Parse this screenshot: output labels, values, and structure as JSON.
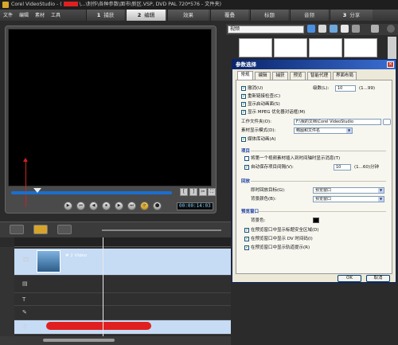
{
  "titlebar": {
    "app": "Corel VideoStudio - (",
    "after_redact": "\\...\\制作\\各种参数\\面市\\新区.VSP, DVD PAL 720*576 - 文件夹)"
  },
  "menu": {
    "file": "文件",
    "edit": "编辑",
    "clip": "素材",
    "tools": "工具"
  },
  "steps": [
    {
      "num": "1",
      "label": "捕获"
    },
    {
      "num": "2",
      "label": "编辑"
    },
    {
      "num": "",
      "label": "效果"
    },
    {
      "num": "",
      "label": "覆叠"
    },
    {
      "num": "",
      "label": "标题"
    },
    {
      "num": "",
      "label": "音频"
    },
    {
      "num": "3",
      "label": "分享"
    }
  ],
  "player": {
    "timecode": "00:00:14:03",
    "buttons": [
      "▶",
      "⏮",
      "◀",
      "⏹",
      "▶",
      "⏭",
      "⟳",
      "⬤"
    ]
  },
  "library": {
    "category": "视频"
  },
  "dialog": {
    "title": "参数选择",
    "close": "×",
    "tabs": [
      "常规",
      "编辑",
      "捕获",
      "预览",
      "智能代理",
      "界面布局"
    ],
    "rows": {
      "undo": "撤消(U)",
      "undo_levels_label": "级数(L):",
      "undo_levels": "10",
      "undo_range": "(1...99)",
      "relink": "重新链接检查(C)",
      "show_start": "显示启动画面(S)",
      "show_mpeg": "显示 MPEG 优化器对话框(M)",
      "workdir_label": "工作文件夹(O):",
      "workdir": "F:\\我的文档\\Corel VideoStudio",
      "autosave_label": "素材显示模式(D):",
      "autosave_value": "略图和文件名",
      "media_import": "媒体库动画(A)"
    },
    "project_section": "项目",
    "project_rows": {
      "insert_into": "将第一个视频素材插入到时间轴时显示消息(T)",
      "autosave": "自动保存项目间隔(V):",
      "autosave_value": "10",
      "autosave_unit": "(1...60)分钟"
    },
    "playback_section": "回放",
    "playback_rows": {
      "instant_label": "即时回放目标(G):",
      "instant_value": "预览窗口",
      "preview_label": "背景颜色(B):",
      "preview_value": "预览窗口"
    },
    "preview_section": "预览窗口",
    "preview_rows": {
      "bg_label": "背景色:",
      "show_title": "在预览窗口中显示标题安全区域(D)",
      "show_dv": "在预览窗口中显示 DV 时间码(I)",
      "show_track": "在预览窗口中显示轨道提示(R)"
    },
    "ok": "OK",
    "cancel": "取消"
  },
  "timeline": {
    "clip_label": "# 1 Video",
    "track_icons": [
      "🎞",
      "▤",
      "T",
      "✎",
      "♫"
    ]
  },
  "colors": {
    "accent": "#d6a42a",
    "dialog_title": "#0a246a",
    "track": "#c6dbf4",
    "redaction": "#e02020"
  }
}
